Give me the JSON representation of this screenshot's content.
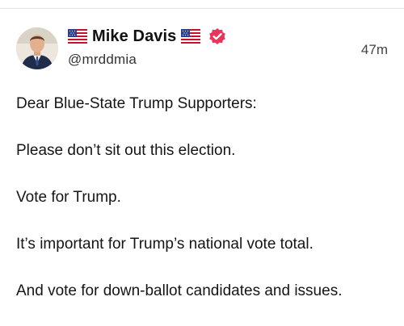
{
  "author": {
    "display_name": "Mike Davis",
    "handle": "@mrddmia",
    "verified": true,
    "badge_color": "#e8355b",
    "flag_before_name": "us-flag-icon",
    "flag_after_name": "us-flag-icon"
  },
  "post": {
    "timestamp": "47m",
    "paragraphs": [
      "Dear Blue-State Trump Supporters:",
      "Please don’t sit out this election.",
      "Vote for Trump.",
      "It’s important for Trump’s national vote total.",
      "And vote for down-ballot candidates and issues."
    ]
  }
}
